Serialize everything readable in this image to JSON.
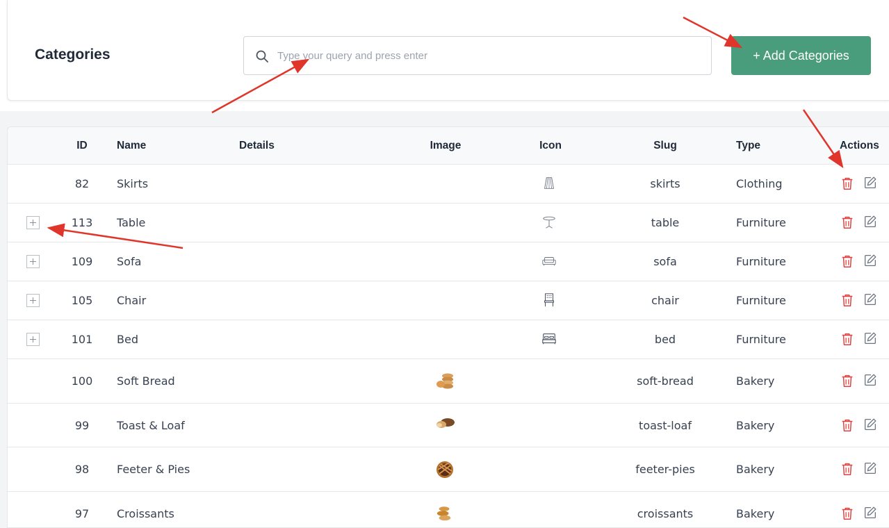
{
  "header": {
    "title": "Categories",
    "search_placeholder": "Type your query and press enter",
    "add_button_label": "+ Add Categories"
  },
  "table": {
    "columns": {
      "id": "ID",
      "name": "Name",
      "details": "Details",
      "image": "Image",
      "icon": "Icon",
      "slug": "Slug",
      "type": "Type",
      "actions": "Actions"
    },
    "rows": [
      {
        "id": "82",
        "name": "Skirts",
        "slug": "skirts",
        "type": "Clothing",
        "icon": "skirt-icon",
        "image": "",
        "expandable": false
      },
      {
        "id": "113",
        "name": "Table",
        "slug": "table",
        "type": "Furniture",
        "icon": "table-icon",
        "image": "",
        "expandable": true
      },
      {
        "id": "109",
        "name": "Sofa",
        "slug": "sofa",
        "type": "Furniture",
        "icon": "sofa-icon",
        "image": "",
        "expandable": true
      },
      {
        "id": "105",
        "name": "Chair",
        "slug": "chair",
        "type": "Furniture",
        "icon": "chair-icon",
        "image": "",
        "expandable": true
      },
      {
        "id": "101",
        "name": "Bed",
        "slug": "bed",
        "type": "Furniture",
        "icon": "bed-icon",
        "image": "",
        "expandable": true
      },
      {
        "id": "100",
        "name": "Soft Bread",
        "slug": "soft-bread",
        "type": "Bakery",
        "icon": "",
        "image": "soft-bread-image",
        "expandable": false
      },
      {
        "id": "99",
        "name": "Toast & Loaf",
        "slug": "toast-loaf",
        "type": "Bakery",
        "icon": "",
        "image": "toast-loaf-image",
        "expandable": false
      },
      {
        "id": "98",
        "name": "Feeter & Pies",
        "slug": "feeter-pies",
        "type": "Bakery",
        "icon": "",
        "image": "pie-image",
        "expandable": false
      },
      {
        "id": "97",
        "name": "Croissants",
        "slug": "croissants",
        "type": "Bakery",
        "icon": "",
        "image": "croissant-image",
        "expandable": false
      }
    ]
  },
  "colors": {
    "accent": "#4a9d7c",
    "delete": "#e53e3e",
    "annotation_arrow": "#e0352b"
  }
}
